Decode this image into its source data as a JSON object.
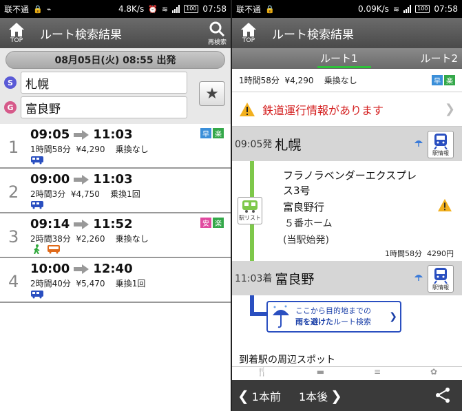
{
  "left": {
    "status": {
      "carrier": "联不通",
      "speed": "4.8K/s",
      "battery": "100",
      "time": "07:58"
    },
    "appbar": {
      "home_label": "TOP",
      "title": "ルート検索結果",
      "search_label": "再検索"
    },
    "date_button": "08月05日(火) 08:55 出発",
    "from": {
      "badge": "S",
      "name": "札幌"
    },
    "to": {
      "badge": "G",
      "name": "富良野"
    },
    "routes": [
      {
        "num": "1",
        "dep": "09:05",
        "arr": "11:03",
        "detail": "1時間58分  ¥4,290    乗換なし",
        "tags": [
          "早",
          "楽"
        ]
      },
      {
        "num": "2",
        "dep": "09:00",
        "arr": "11:03",
        "detail": "2時間3分  ¥4,750    乗換1回",
        "tags": []
      },
      {
        "num": "3",
        "dep": "09:14",
        "arr": "11:52",
        "detail": "2時間38分  ¥2,260    乗換なし",
        "tags": [
          "安",
          "楽"
        ]
      },
      {
        "num": "4",
        "dep": "10:00",
        "arr": "12:40",
        "detail": "2時間40分  ¥5,470    乗換1回",
        "tags": []
      }
    ]
  },
  "right": {
    "status": {
      "carrier": "联不通",
      "speed": "0.09K/s",
      "battery": "100",
      "time": "07:58"
    },
    "appbar": {
      "home_label": "TOP",
      "title": "ルート検索結果"
    },
    "tabs": {
      "tab1": "ルート1",
      "tab2": "ルート2"
    },
    "summary": "1時間58分  ¥4,290    乗換なし",
    "summary_tags": [
      "早",
      "楽"
    ],
    "alert": "鉄道運行情報があります",
    "departure": {
      "time": "09:05発",
      "station": "札幌",
      "button": "駅情報"
    },
    "segment": {
      "list_button": "駅リスト",
      "train": "フラノラベンダーエクスプレス3号",
      "destination": "富良野行",
      "platform": "５番ホーム",
      "note": "(当駅始発)",
      "summary": "1時間58分  4290円"
    },
    "arrival": {
      "time": "11:03着",
      "station": "富良野",
      "button": "駅情報"
    },
    "rain": {
      "line1": "ここから目的地までの",
      "line2_bold": "雨を避けた",
      "line2_rest": "ルート検索"
    },
    "spots_title": "到着駅の周辺スポット",
    "bottom": {
      "prev": "1本前",
      "next": "1本後"
    }
  }
}
